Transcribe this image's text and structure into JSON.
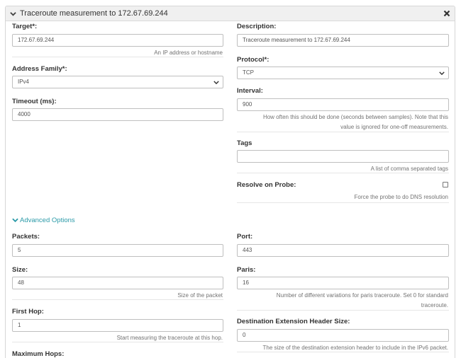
{
  "panel": {
    "title": "Traceroute measurement to 172.67.69.244",
    "close_label": "✖"
  },
  "form": {
    "target": {
      "label": "Target*:",
      "value": "172.67.69.244",
      "help": "An IP address or hostname"
    },
    "description": {
      "label": "Description:",
      "value": "Traceroute measurement to 172.67.69.244"
    },
    "address_family": {
      "label": "Address Family*:",
      "value": "IPv4"
    },
    "protocol": {
      "label": "Protocol*:",
      "value": "TCP"
    },
    "timeout": {
      "label": "Timeout (ms):",
      "value": "4000"
    },
    "interval": {
      "label": "Interval:",
      "value": "900",
      "help_line1": "How often this should be done (seconds between samples). Note that this",
      "help_line2": "value is ignored for one-off measurements."
    },
    "tags": {
      "label": "Tags",
      "value": "",
      "help": "A list of comma separated tags"
    },
    "resolve_on_probe": {
      "label": "Resolve on Probe:",
      "checked": false,
      "help": "Force the probe to do DNS resolution"
    }
  },
  "advanced": {
    "toggle_label": "Advanced Options",
    "packets": {
      "label": "Packets:",
      "value": "5"
    },
    "port": {
      "label": "Port:",
      "value": "443"
    },
    "size": {
      "label": "Size:",
      "value": "48",
      "help": "Size of the packet"
    },
    "paris": {
      "label": "Paris:",
      "value": "16",
      "help_line1": "Number of different variations for paris traceroute. Set 0 for standard",
      "help_line2": "traceroute."
    },
    "first_hop": {
      "label": "First Hop:",
      "value": "1",
      "help": "Start measuring the traceroute at this hop."
    },
    "dest_ext_header": {
      "label": "Destination Extension Header Size:",
      "value": "0",
      "help": "The size of the destination extension header to include in the IPv6 packet."
    },
    "max_hops": {
      "label": "Maximum Hops:"
    }
  },
  "colors": {
    "accent": "#2b9aa8",
    "header_bg": "#f0f0f0",
    "border": "#bfbfbf"
  }
}
